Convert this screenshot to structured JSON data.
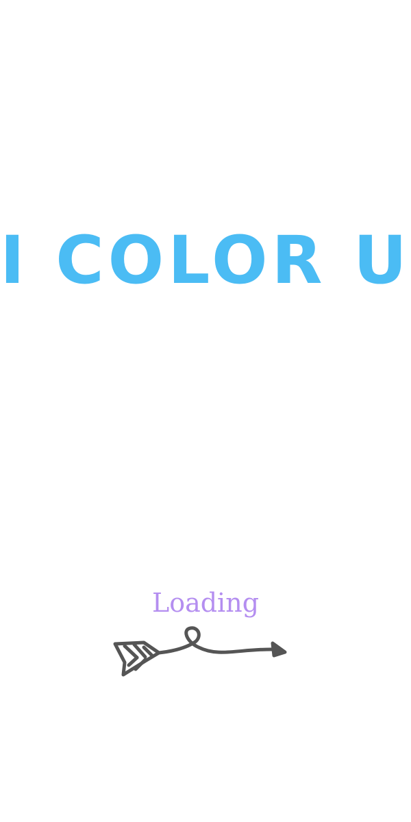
{
  "app": {
    "title": "I COLOR U",
    "title_color": "#4bbcf4"
  },
  "splash": {
    "loading_label": "Loading",
    "loading_color": "#b48ef0",
    "indicator_icon": "hand-drawn-arrow-icon",
    "indicator_color": "#555555"
  }
}
